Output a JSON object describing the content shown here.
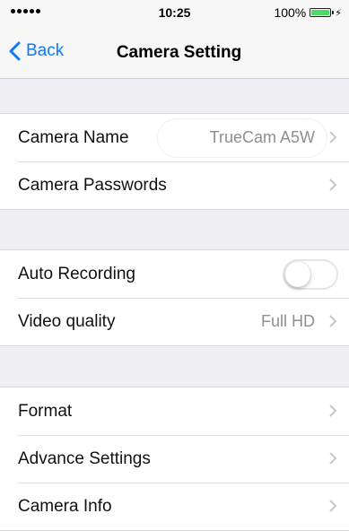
{
  "status_bar": {
    "time": "10:25",
    "battery_percent_label": "100%",
    "battery_level": 1.0,
    "signal_dots": 5
  },
  "nav": {
    "back_label": "Back",
    "title": "Camera Setting"
  },
  "groups": {
    "camera": {
      "name_label": "Camera Name",
      "name_value": "TrueCam A5W",
      "passwords_label": "Camera Passwords"
    },
    "recording": {
      "auto_label": "Auto Recording",
      "auto_on": false,
      "quality_label": "Video quality",
      "quality_value": "Full HD"
    },
    "system": {
      "format_label": "Format",
      "advance_label": "Advance Settings",
      "info_label": "Camera Info"
    }
  },
  "colors": {
    "accent": "#0a7bff",
    "battery_fill": "#4cd964",
    "background": "#efeff4",
    "secondary_text": "#8e8e93"
  },
  "icons": {
    "back": "chevron-left-icon",
    "disclosure": "chevron-right-icon"
  }
}
